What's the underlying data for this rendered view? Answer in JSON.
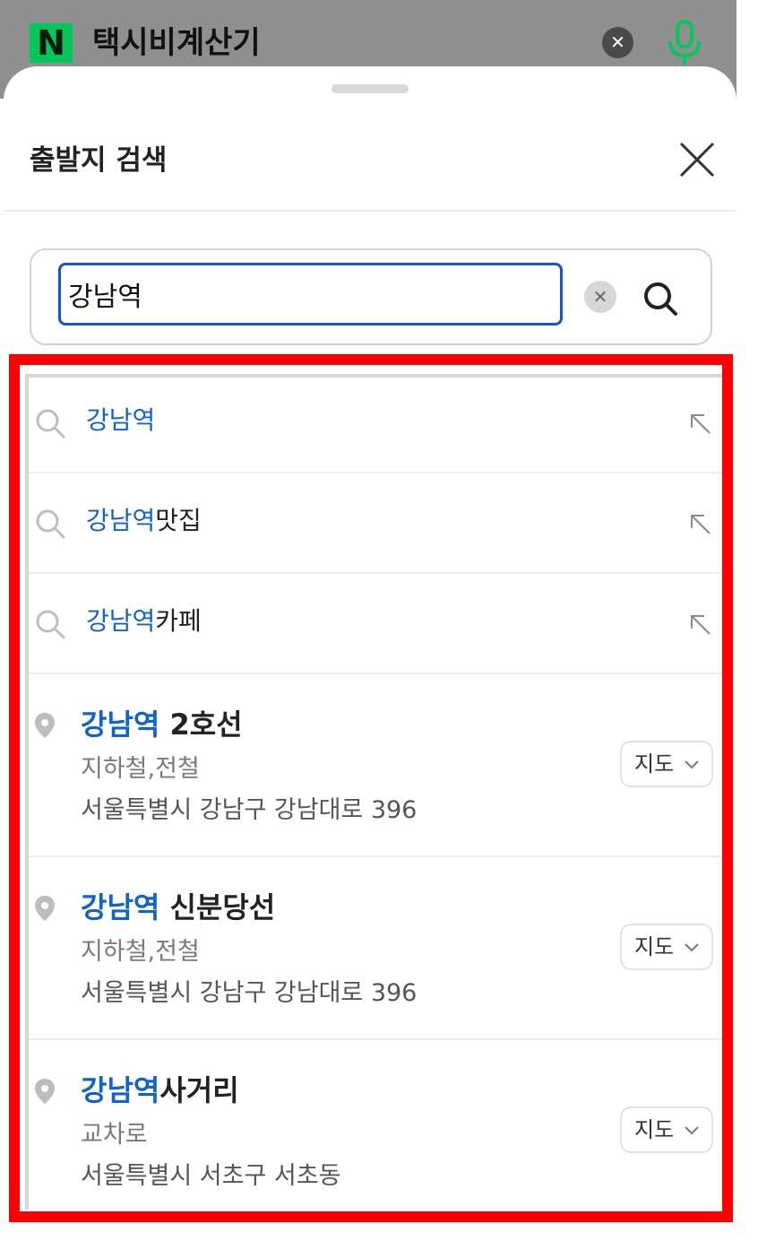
{
  "topbar": {
    "logo_letter": "N",
    "query": "택시비계산기",
    "clear_icon": "close-circle-icon",
    "mic_icon": "microphone-icon",
    "accent": "#03c75a"
  },
  "sheet": {
    "title": "출발지 검색",
    "close_icon": "close-icon"
  },
  "search": {
    "value": "강남역",
    "clear_icon": "clear-input-icon",
    "search_icon": "search-icon"
  },
  "suggestions": [
    {
      "match": "강남역",
      "rest": "",
      "icon": "search-icon",
      "action_icon": "arrow-up-left-icon"
    },
    {
      "match": "강남역",
      "rest": "맛집",
      "icon": "search-icon",
      "action_icon": "arrow-up-left-icon"
    },
    {
      "match": "강남역",
      "rest": "카페",
      "icon": "search-icon",
      "action_icon": "arrow-up-left-icon"
    }
  ],
  "places": [
    {
      "match": "강남역",
      "rest": " 2호선",
      "category": "지하철,전철",
      "address": "서울특별시 강남구 강남대로 396",
      "map_label": "지도"
    },
    {
      "match": "강남역",
      "rest": " 신분당선",
      "category": "지하철,전철",
      "address": "서울특별시 강남구 강남대로 396",
      "map_label": "지도"
    },
    {
      "match": "강남역",
      "rest": "사거리",
      "category": "교차로",
      "address": "서울특별시 서초구 서초동",
      "map_label": "지도"
    }
  ],
  "colors": {
    "highlight_text": "#1263c6",
    "annotation_border": "#ff0000",
    "input_border": "#1257c8"
  }
}
